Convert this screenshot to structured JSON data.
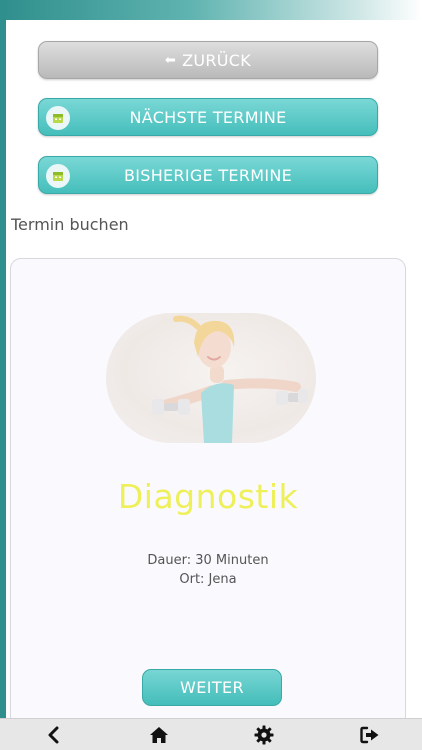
{
  "header": {
    "back_label": "ZURÜCK",
    "next_appointments_label": "NÄCHSTE TERMINE",
    "past_appointments_label": "BISHERIGE TERMINE"
  },
  "section": {
    "title": "Termin buchen"
  },
  "service": {
    "name": "Diagnostik",
    "duration": "Dauer: 30 Minuten",
    "location": "Ort: Jena",
    "continue_label": "WEITER"
  },
  "bottom_nav": {
    "items": [
      {
        "icon": "chevron-left-icon"
      },
      {
        "icon": "home-icon"
      },
      {
        "icon": "gear-icon"
      },
      {
        "icon": "logout-icon"
      }
    ]
  },
  "colors": {
    "accent": "#45bebb",
    "title_yellow": "#eef05a",
    "back_gray": "#b9b9b9",
    "strip_teal": "#2f8f8c"
  }
}
